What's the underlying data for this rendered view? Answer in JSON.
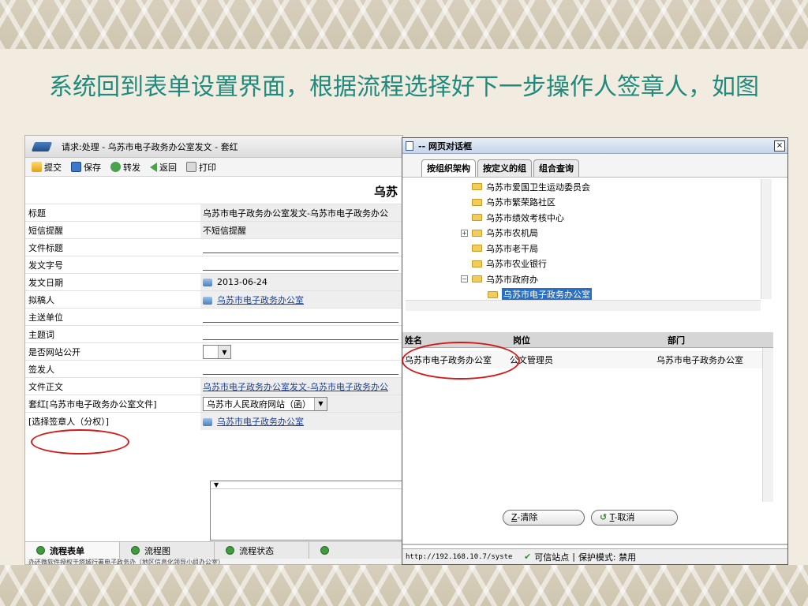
{
  "slide": {
    "title": "系统回到表单设置界面，根据流程选择好下一步操作人签章人，如图"
  },
  "left_window": {
    "title": "请求:处理 - 乌苏市电子政务办公室发文 - 套红",
    "toolbar": {
      "submit": "提交",
      "save": "保存",
      "forward": "转发",
      "back": "返回",
      "print": "打印"
    },
    "doc_heading": "乌苏",
    "fields": [
      {
        "label": "标题",
        "value": "乌苏市电子政务办公室发文-乌苏市电子政务办公"
      },
      {
        "label": "短信提醒",
        "value": "不短信提醒"
      },
      {
        "label": "文件标题",
        "value": ""
      },
      {
        "label": "发文字号",
        "value": ""
      },
      {
        "label": "发文日期",
        "value": "2013-06-24"
      },
      {
        "label": "拟稿人",
        "value": "乌苏市电子政务办公室"
      },
      {
        "label": "主送单位",
        "value": ""
      },
      {
        "label": "主题词",
        "value": ""
      },
      {
        "label": "是否网站公开",
        "value": ""
      },
      {
        "label": "签发人",
        "value": ""
      },
      {
        "label": "文件正文",
        "value": "乌苏市电子政务办公室发文-乌苏市电子政务办公"
      },
      {
        "label": "套红[乌苏市电子政务办公室文件]",
        "value": "乌苏市人民政府网站（函）"
      },
      {
        "label": "[选择签章人（分权）]",
        "value": "乌苏市电子政务办公室"
      }
    ],
    "tabs": [
      "流程表单",
      "流程图",
      "流程状态"
    ],
    "status_text": "办还微软件授权于塔城行署电子政务办（地区信息化领导小组办公室）"
  },
  "dialog": {
    "title": "-- 网页对话框",
    "close_label": "×",
    "tabs": [
      "按组织架构",
      "按定义的组",
      "组合查询"
    ],
    "tree": [
      {
        "label": "乌苏市爱国卫生运动委员会",
        "expander": ""
      },
      {
        "label": "乌苏市繁荣路社区",
        "expander": ""
      },
      {
        "label": "乌苏市绩效考核中心",
        "expander": ""
      },
      {
        "label": "乌苏市农机局",
        "expander": "+"
      },
      {
        "label": "乌苏市老干局",
        "expander": ""
      },
      {
        "label": "乌苏市农业银行",
        "expander": ""
      },
      {
        "label": "乌苏市政府办",
        "expander": "−"
      },
      {
        "label": "乌苏市电子政务办公室",
        "expander": "",
        "selected": true
      }
    ],
    "result_headers": [
      "姓名",
      "岗位",
      "部门"
    ],
    "result_rows": [
      {
        "name": "乌苏市电子政务办公室",
        "post": "公文管理员",
        "dept": "乌苏市电子政务办公室"
      }
    ],
    "buttons": {
      "clear_key": "Z",
      "clear_label": "-清除",
      "cancel_key": "T",
      "cancel_label": "-取消"
    },
    "status": {
      "url": "http://192.168.10.7/syste",
      "trusted": "可信站点",
      "protected_mode": "保护模式: 禁用"
    }
  }
}
